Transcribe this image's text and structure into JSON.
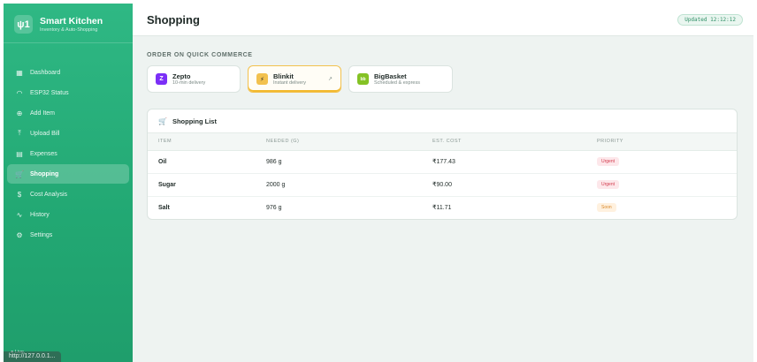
{
  "sidebar": {
    "brand": {
      "logo": "ψ1",
      "name": "Smart Kitchen",
      "tagline": "Inventory & Auto-Shopping"
    },
    "items": [
      {
        "label": "Dashboard",
        "icon": "grid-icon",
        "glyph": "▦"
      },
      {
        "label": "ESP32 Status",
        "icon": "wifi-icon",
        "glyph": "◠"
      },
      {
        "label": "Add Item",
        "icon": "plus-circle-icon",
        "glyph": "⊕"
      },
      {
        "label": "Upload Bill",
        "icon": "upload-icon",
        "glyph": "⤒"
      },
      {
        "label": "Expenses",
        "icon": "wallet-icon",
        "glyph": "▤"
      },
      {
        "label": "Shopping",
        "icon": "cart-icon",
        "glyph": "🛒"
      },
      {
        "label": "Cost Analysis",
        "icon": "dollar-icon",
        "glyph": "$"
      },
      {
        "label": "History",
        "icon": "activity-icon",
        "glyph": "∿"
      },
      {
        "label": "Settings",
        "icon": "gear-icon",
        "glyph": "⚙"
      }
    ],
    "active_index": 5,
    "footer": "● Live",
    "url_strip": "http://127.0.0.1..."
  },
  "header": {
    "title": "Shopping",
    "updated": "Updated 12:12:12"
  },
  "quick_commerce": {
    "label": "ORDER ON QUICK COMMERCE",
    "options": [
      {
        "name": "Zepto",
        "desc": "10-min delivery",
        "logo": "Z",
        "color": "#7b2ff7"
      },
      {
        "name": "Blinkit",
        "desc": "Instant delivery",
        "logo": "⚡",
        "color": "#f2c14e",
        "selected": true
      },
      {
        "name": "BigBasket",
        "desc": "Scheduled & express",
        "logo": "bb",
        "color": "#84c225"
      }
    ]
  },
  "shopping_list": {
    "title": "Shopping List",
    "columns": [
      "ITEM",
      "NEEDED (G)",
      "EST. COST",
      "PRIORITY"
    ],
    "rows": [
      {
        "item": "Oil",
        "needed": "986 g",
        "cost": "₹177.43",
        "priority": "Urgent",
        "level": "urgent"
      },
      {
        "item": "Sugar",
        "needed": "2000 g",
        "cost": "₹90.00",
        "priority": "Urgent",
        "level": "urgent"
      },
      {
        "item": "Salt",
        "needed": "976 g",
        "cost": "₹11.71",
        "priority": "Soon",
        "level": "soon"
      }
    ]
  },
  "colors": {
    "sidebar": "#22a873",
    "accent": "#2e8f66",
    "urgent": "#d23a4c",
    "soon": "#d9892a"
  }
}
